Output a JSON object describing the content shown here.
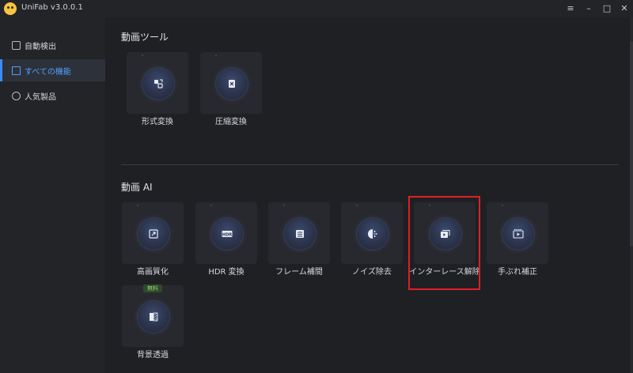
{
  "window": {
    "title": "UniFab v3.0.0.1",
    "controls": [
      "≡",
      "–",
      "□",
      "✕"
    ]
  },
  "sidebar": {
    "items": [
      {
        "label": "自動検出",
        "icon": "auto-detect-icon",
        "active": false
      },
      {
        "label": "すべての機能",
        "icon": "all-features-icon",
        "active": true
      },
      {
        "label": "人気製品",
        "icon": "popular-products-icon",
        "active": false
      }
    ]
  },
  "sections": [
    {
      "title": "動画ツール",
      "tools": [
        {
          "label": "形式変換",
          "icon": "format-convert-icon"
        },
        {
          "label": "圧縮変換",
          "icon": "compress-icon"
        }
      ]
    },
    {
      "title": "動画 AI",
      "tools": [
        {
          "label": "高画質化",
          "icon": "upscale-icon"
        },
        {
          "label": "HDR 変換",
          "icon": "hdr-icon",
          "glyph_text": "HDR"
        },
        {
          "label": "フレーム補間",
          "icon": "frame-interpolation-icon"
        },
        {
          "label": "ノイズ除去",
          "icon": "denoise-icon"
        },
        {
          "label": "インターレース解除",
          "icon": "deinterlace-icon",
          "highlighted": true
        },
        {
          "label": "手ぶれ補正",
          "icon": "stabilize-icon"
        },
        {
          "label": "背景透過",
          "icon": "background-remove-icon",
          "badge": "無料"
        }
      ]
    }
  ],
  "colors": {
    "accent": "#4ea2ff",
    "highlight": "#e01f26",
    "badge_text": "#8fd17a"
  }
}
